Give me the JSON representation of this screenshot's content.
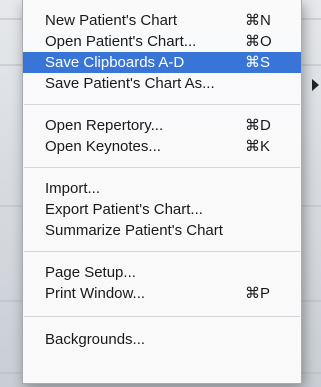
{
  "menu": {
    "items": [
      {
        "label": "New Patient's Chart",
        "shortcut": "⌘N"
      },
      {
        "label": "Open Patient's Chart...",
        "shortcut": "⌘O"
      },
      {
        "label": "Save Clipboards A-D",
        "shortcut": "⌘S",
        "selected": true
      },
      {
        "label": "Save Patient's Chart As...",
        "shortcut": ""
      },
      {
        "label": "Open Repertory...",
        "shortcut": "⌘D"
      },
      {
        "label": "Open Keynotes...",
        "shortcut": "⌘K"
      },
      {
        "label": "Import...",
        "shortcut": ""
      },
      {
        "label": "Export Patient's Chart...",
        "shortcut": ""
      },
      {
        "label": "Summarize Patient's Chart",
        "shortcut": ""
      },
      {
        "label": "Page Setup...",
        "shortcut": ""
      },
      {
        "label": "Print Window...",
        "shortcut": "⌘P"
      },
      {
        "label": "Backgrounds...",
        "shortcut": ""
      }
    ]
  },
  "colors": {
    "highlight": "#3875d7",
    "menu_background": "#fafafb",
    "text": "#1a1a1a"
  }
}
